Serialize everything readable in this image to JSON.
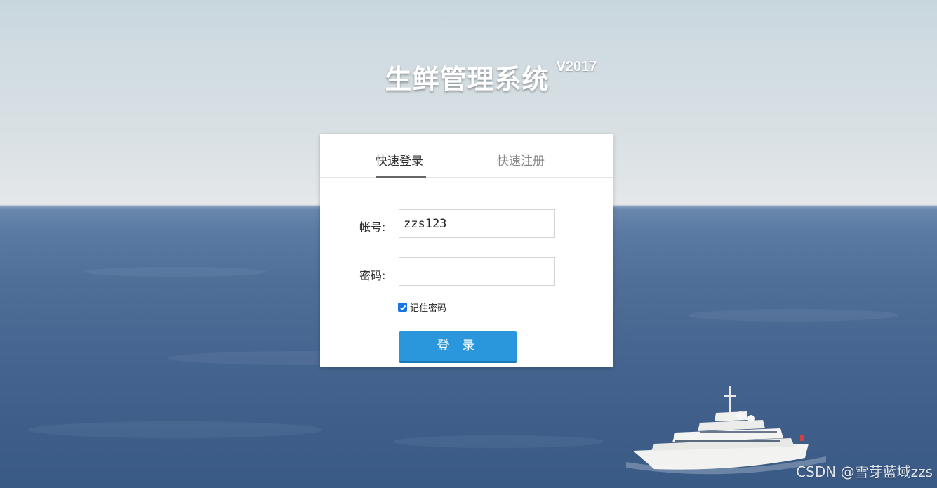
{
  "header": {
    "title": "生鲜管理系统",
    "version": "V2017"
  },
  "tabs": [
    {
      "label": "快速登录",
      "active": true
    },
    {
      "label": "快速注册",
      "active": false
    }
  ],
  "form": {
    "account_label": "帐号:",
    "account_value": "zzs123",
    "password_label": "密码:",
    "password_value": "",
    "remember_label": "记住密码",
    "remember_checked": true,
    "submit_label": "登 录"
  },
  "watermark": "CSDN @雪芽蓝域zzs",
  "colors": {
    "primary_button": "#2a97dc",
    "checkbox": "#1a73e8"
  }
}
